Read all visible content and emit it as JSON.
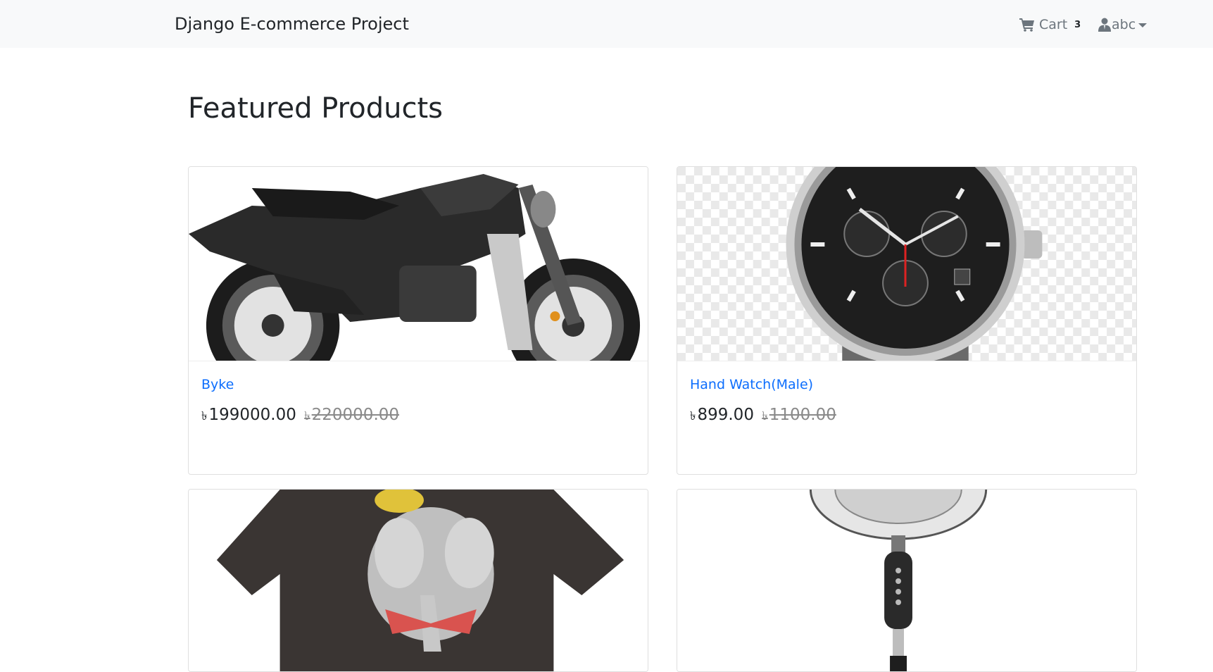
{
  "navbar": {
    "brand": "Django E-commerce Project",
    "cart_label": "Cart",
    "cart_count": "3",
    "user_name": "abc"
  },
  "page_title": "Featured Products",
  "currency_symbol": "৳",
  "products": [
    {
      "name": "Byke",
      "price": "199000.00",
      "old_price": "220000.00",
      "image": "motorcycle"
    },
    {
      "name": "Hand Watch(Male)",
      "price": "899.00",
      "old_price": "1100.00",
      "image": "wristwatch"
    },
    {
      "name": "",
      "price": "",
      "old_price": "",
      "image": "tshirt"
    },
    {
      "name": "",
      "price": "",
      "old_price": "",
      "image": "stand-fan"
    }
  ],
  "colors": {
    "navbar_bg": "#f8f9fa",
    "link": "#0d6efd",
    "muted": "#6c757d"
  }
}
